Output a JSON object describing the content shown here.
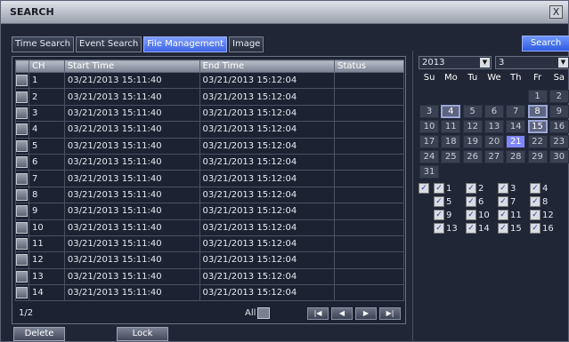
{
  "window": {
    "title": "SEARCH",
    "close_glyph": "X"
  },
  "tabs": [
    {
      "label": "Time Search",
      "active": false
    },
    {
      "label": "Event Search",
      "active": false
    },
    {
      "label": "File Management",
      "active": true
    },
    {
      "label": "Image",
      "active": false
    }
  ],
  "search_button": "Search",
  "table": {
    "headers": [
      "CH",
      "Start Time",
      "End Time",
      "Status"
    ],
    "rows": [
      {
        "ch": "1",
        "start": "03/21/2013 15:11:40",
        "end": "03/21/2013 15:12:04",
        "status": ""
      },
      {
        "ch": "2",
        "start": "03/21/2013 15:11:40",
        "end": "03/21/2013 15:12:04",
        "status": ""
      },
      {
        "ch": "3",
        "start": "03/21/2013 15:11:40",
        "end": "03/21/2013 15:12:04",
        "status": ""
      },
      {
        "ch": "4",
        "start": "03/21/2013 15:11:40",
        "end": "03/21/2013 15:12:04",
        "status": ""
      },
      {
        "ch": "5",
        "start": "03/21/2013 15:11:40",
        "end": "03/21/2013 15:12:04",
        "status": ""
      },
      {
        "ch": "6",
        "start": "03/21/2013 15:11:40",
        "end": "03/21/2013 15:12:04",
        "status": ""
      },
      {
        "ch": "7",
        "start": "03/21/2013 15:11:40",
        "end": "03/21/2013 15:12:04",
        "status": ""
      },
      {
        "ch": "8",
        "start": "03/21/2013 15:11:40",
        "end": "03/21/2013 15:12:04",
        "status": ""
      },
      {
        "ch": "9",
        "start": "03/21/2013 15:11:40",
        "end": "03/21/2013 15:12:04",
        "status": ""
      },
      {
        "ch": "10",
        "start": "03/21/2013 15:11:40",
        "end": "03/21/2013 15:12:04",
        "status": ""
      },
      {
        "ch": "11",
        "start": "03/21/2013 15:11:40",
        "end": "03/21/2013 15:12:04",
        "status": ""
      },
      {
        "ch": "12",
        "start": "03/21/2013 15:11:40",
        "end": "03/21/2013 15:12:04",
        "status": ""
      },
      {
        "ch": "13",
        "start": "03/21/2013 15:11:40",
        "end": "03/21/2013 15:12:04",
        "status": ""
      },
      {
        "ch": "14",
        "start": "03/21/2013 15:11:40",
        "end": "03/21/2013 15:12:04",
        "status": ""
      }
    ]
  },
  "pager": {
    "page": "1/2",
    "all_label": "All"
  },
  "pager_buttons": [
    {
      "name": "first-page-button",
      "glyph": "|◀"
    },
    {
      "name": "prev-page-button",
      "glyph": "◀"
    },
    {
      "name": "next-page-button",
      "glyph": "▶"
    },
    {
      "name": "last-page-button",
      "glyph": "▶|"
    }
  ],
  "actions": {
    "delete": "Delete",
    "lock": "Lock"
  },
  "calendar": {
    "year": "2013",
    "month": "3",
    "weekdays": [
      "Su",
      "Mo",
      "Tu",
      "We",
      "Th",
      "Fr",
      "Sa"
    ],
    "weeks": [
      [
        "",
        "",
        "",
        "",
        "",
        "1",
        "2"
      ],
      [
        "3",
        "4",
        "5",
        "6",
        "7",
        "8",
        "9"
      ],
      [
        "10",
        "11",
        "12",
        "13",
        "14",
        "15",
        "16"
      ],
      [
        "17",
        "18",
        "19",
        "20",
        "21",
        "22",
        "23"
      ],
      [
        "24",
        "25",
        "26",
        "27",
        "28",
        "29",
        "30"
      ],
      [
        "31",
        "",
        "",
        "",
        "",
        "",
        ""
      ]
    ],
    "recorded_days": [
      "4",
      "8",
      "15"
    ],
    "selected_day": "21"
  },
  "channels": {
    "all_checked": true,
    "list": [
      "1",
      "2",
      "3",
      "4",
      "5",
      "6",
      "7",
      "8",
      "9",
      "10",
      "11",
      "12",
      "13",
      "14",
      "15",
      "16"
    ],
    "check_glyph": "✓"
  }
}
